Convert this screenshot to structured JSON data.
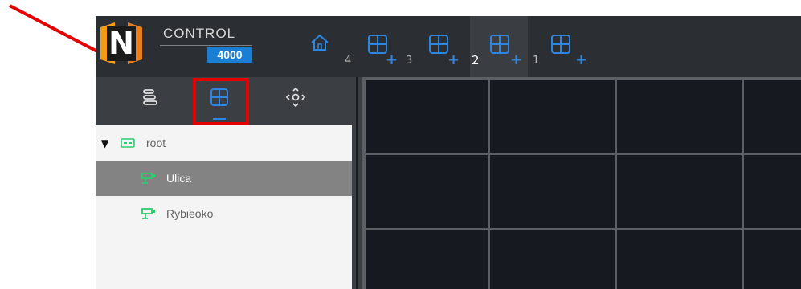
{
  "header": {
    "logo_letter": "N",
    "brand_name": "CONTROL",
    "brand_number": "4000",
    "home_icon": "home-icon",
    "layout_tabs": [
      {
        "number": "4",
        "icon": "grid-layout-icon",
        "active": false
      },
      {
        "number": "3",
        "icon": "grid-layout-icon",
        "active": false
      },
      {
        "number": "2",
        "icon": "grid-layout-icon",
        "active": true
      },
      {
        "number": "1",
        "icon": "grid-layout-icon",
        "active": false
      }
    ],
    "add_symbol": "+"
  },
  "panel_toolbar": {
    "tools": [
      {
        "name": "device-list-icon",
        "selected": false
      },
      {
        "name": "grid-layout-icon",
        "selected": true
      },
      {
        "name": "ptz-control-icon",
        "selected": false
      }
    ]
  },
  "tree": {
    "root": {
      "label": "root",
      "icon": "recorder-icon",
      "expanded": true
    },
    "cameras": [
      {
        "label": "Ulica",
        "icon": "camera-icon",
        "selected": true
      },
      {
        "label": "Rybieoko",
        "icon": "camera-icon",
        "selected": false
      }
    ]
  },
  "colors": {
    "accent": "#2e86de",
    "camera_green": "#2ecc71",
    "selection": "#838383",
    "annotation_red": "#e60000"
  }
}
